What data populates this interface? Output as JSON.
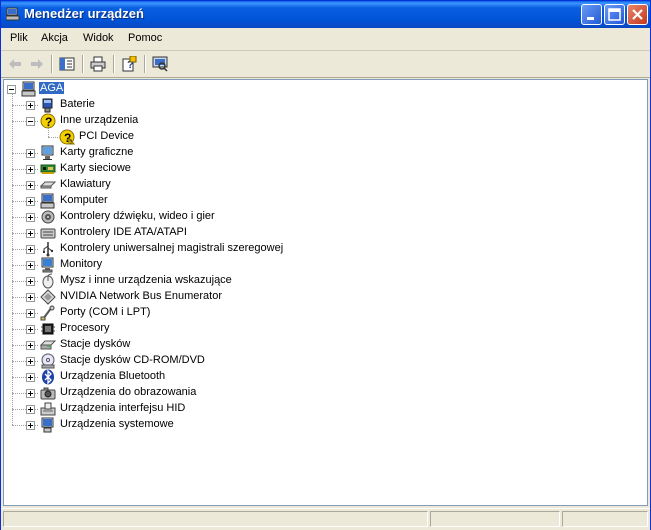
{
  "window": {
    "title": "Menedżer urządzeń"
  },
  "menu": [
    "Plik",
    "Akcja",
    "Widok",
    "Pomoc"
  ],
  "toolbar": {
    "buttons": [
      "back-icon",
      "forward-icon",
      "show-hide-tree-icon",
      "print-icon",
      "properties-help-icon",
      "scan-hardware-icon"
    ]
  },
  "tree": {
    "root": "AGA",
    "categories": [
      {
        "label": "Baterie",
        "icon": "battery-icon",
        "expanded": false
      },
      {
        "label": "Inne urządzenia",
        "icon": "unknown-device-icon",
        "expanded": true,
        "children": [
          "PCI Device"
        ]
      },
      {
        "label": "Karty graficzne",
        "icon": "display-adapter-icon",
        "expanded": false
      },
      {
        "label": "Karty sieciowe",
        "icon": "network-adapter-icon",
        "expanded": false
      },
      {
        "label": "Klawiatury",
        "icon": "keyboard-icon",
        "expanded": false
      },
      {
        "label": "Komputer",
        "icon": "computer-icon",
        "expanded": false
      },
      {
        "label": "Kontrolery dźwięku, wideo i gier",
        "icon": "sound-icon",
        "expanded": false
      },
      {
        "label": "Kontrolery IDE ATA/ATAPI",
        "icon": "ide-icon",
        "expanded": false
      },
      {
        "label": "Kontrolery uniwersalnej magistrali szeregowej",
        "icon": "usb-icon",
        "expanded": false
      },
      {
        "label": "Monitory",
        "icon": "monitor-icon",
        "expanded": false
      },
      {
        "label": "Mysz i inne urządzenia wskazujące",
        "icon": "mouse-icon",
        "expanded": false
      },
      {
        "label": "NVIDIA Network Bus Enumerator",
        "icon": "nvidia-bus-icon",
        "expanded": false
      },
      {
        "label": "Porty (COM i LPT)",
        "icon": "port-icon",
        "expanded": false
      },
      {
        "label": "Procesory",
        "icon": "processor-icon",
        "expanded": false
      },
      {
        "label": "Stacje dysków",
        "icon": "disk-drive-icon",
        "expanded": false
      },
      {
        "label": "Stacje dysków CD-ROM/DVD",
        "icon": "cdrom-icon",
        "expanded": false
      },
      {
        "label": "Urządzenia Bluetooth",
        "icon": "bluetooth-icon",
        "expanded": false
      },
      {
        "label": "Urządzenia do obrazowania",
        "icon": "imaging-icon",
        "expanded": false
      },
      {
        "label": "Urządzenia interfejsu HID",
        "icon": "hid-icon",
        "expanded": false
      },
      {
        "label": "Urządzenia systemowe",
        "icon": "system-devices-icon",
        "expanded": false
      }
    ]
  },
  "colors": {
    "titlebar": "#0a5fe3",
    "selection": "#316ac5",
    "background": "#ece9d8"
  }
}
